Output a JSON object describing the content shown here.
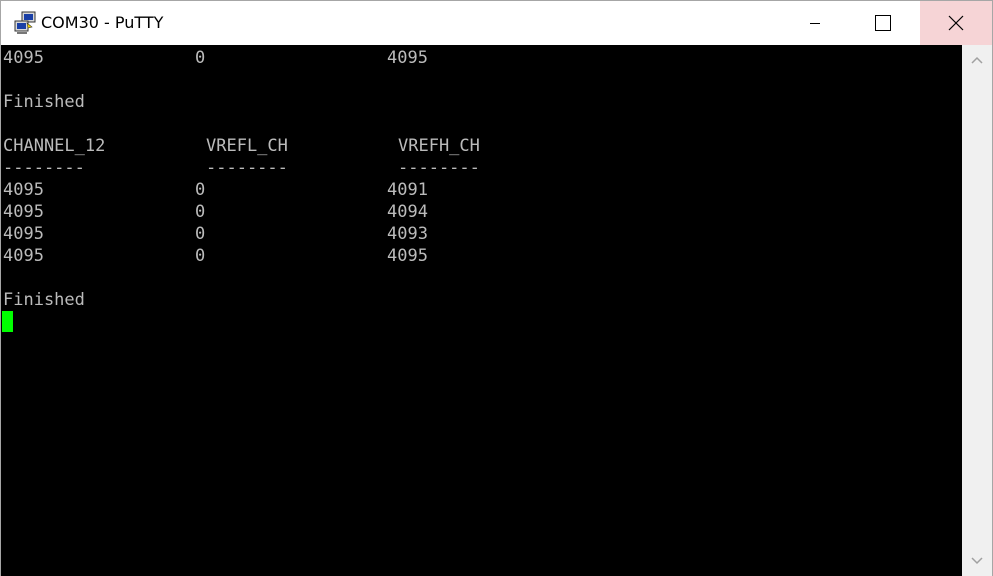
{
  "window": {
    "title": "COM30 - PuTTY",
    "icon": "putty-icon",
    "controls": {
      "minimize": "minimize-icon",
      "maximize": "maximize-icon",
      "close": "close-icon",
      "close_hover_color": "#f6d4d6"
    }
  },
  "terminal": {
    "background": "#000000",
    "foreground": "#bbbbbb",
    "cursor_color": "#00ff00",
    "top_row": [
      "4095",
      "0",
      "4095"
    ],
    "finished_1": "Finished",
    "headers": [
      "CHANNEL_12",
      "VREFL_CH",
      "VREFH_CH"
    ],
    "separators": [
      "--------",
      "--------",
      "--------"
    ],
    "rows": [
      [
        "4095",
        "0",
        "4091"
      ],
      [
        "4095",
        "0",
        "4094"
      ],
      [
        "4095",
        "0",
        "4093"
      ],
      [
        "4095",
        "0",
        "4095"
      ]
    ],
    "finished_2": "Finished"
  },
  "scrollbar": {
    "up": "scroll-up-arrow-icon",
    "down": "scroll-down-arrow-icon"
  }
}
